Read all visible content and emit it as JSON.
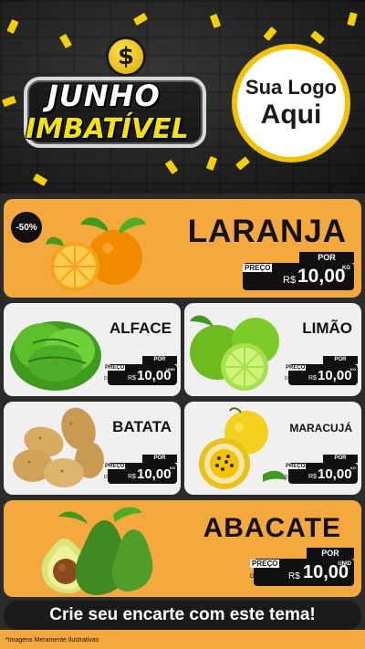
{
  "header": {
    "title_line1": "JUNHO",
    "title_line2": "IMBATÍVEL",
    "coin_symbol": "$",
    "logo_line1": "Sua Logo",
    "logo_line2": "Aqui",
    "colors": {
      "accent": "#f4e400",
      "ring": "#f2c200"
    }
  },
  "products": [
    {
      "name": "LARANJA",
      "badge": "-50%",
      "por": "POR",
      "preco": "PREÇO",
      "de": "DE",
      "old_price": "20,00",
      "currency": "R$",
      "price": "10,00",
      "unit": "KG"
    },
    {
      "name": "ALFACE",
      "por": "POR",
      "preco": "PREÇO",
      "de": "DE",
      "old_price": "20,00",
      "currency": "R$",
      "price": "10,00",
      "unit": "UNID"
    },
    {
      "name": "LIMÃO",
      "por": "POR",
      "preco": "PREÇO",
      "de": "DE",
      "old_price": "20,00",
      "currency": "R$",
      "price": "10,00",
      "unit": "KG"
    },
    {
      "name": "BATATA",
      "por": "POR",
      "preco": "PREÇO",
      "de": "DE",
      "old_price": "20,00",
      "currency": "R$",
      "price": "10,00",
      "unit": "KG"
    },
    {
      "name": "MARACUJÁ",
      "por": "POR",
      "preco": "PREÇO",
      "de": "DE",
      "old_price": "20,00",
      "currency": "R$",
      "price": "10,00",
      "unit": "KG"
    },
    {
      "name": "ABACATE",
      "por": "POR",
      "preco": "PREÇO",
      "de": "DE",
      "old_price": "20,00",
      "currency": "R$",
      "price": "10,00",
      "unit": "UNID"
    }
  ],
  "footer": {
    "cta": "Crie seu encarte com este tema!",
    "note": "*Imagens Meramente Ilustrativas"
  },
  "icons": [
    "dollar-coin-icon",
    "orange-icon",
    "lettuce-icon",
    "lime-icon",
    "potato-icon",
    "passion-fruit-icon",
    "avocado-icon"
  ]
}
